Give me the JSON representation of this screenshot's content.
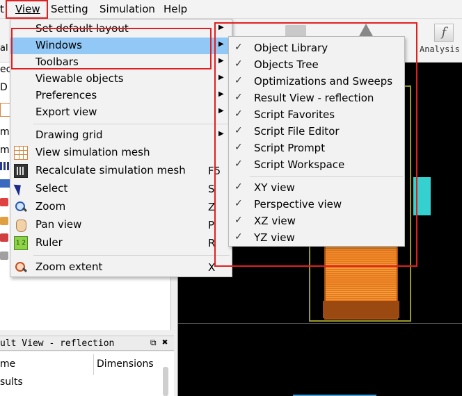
{
  "menubar": {
    "partial_left": "t",
    "view": "View",
    "setting": "Setting",
    "simulation": "Simulation",
    "help": "Help"
  },
  "toolbar": {
    "partial_left": "al",
    "analysis": "Analysis"
  },
  "left_panel": {
    "partial_chars": [
      "ec",
      "D",
      "m",
      "m"
    ]
  },
  "bottom_panel": {
    "title": "ult View - reflection",
    "float_btn": "⧉",
    "close_btn": "✖",
    "col_name": "me",
    "col_dimensions": "Dimensions",
    "row1": "sults"
  },
  "view_menu": {
    "items": [
      {
        "label": "Set default layout",
        "arrow": "▶"
      },
      {
        "label": "Windows",
        "arrow": "▶"
      },
      {
        "label": "Toolbars",
        "arrow": "▶"
      },
      {
        "label": "Viewable objects",
        "arrow": "▶"
      },
      {
        "label": "Preferences",
        "arrow": "▶"
      },
      {
        "label": "Export view",
        "arrow": "▶"
      },
      {
        "label": "Drawing grid",
        "arrow": "▶"
      },
      {
        "label": "View simulation mesh",
        "icon": "mesh-grid-icon"
      },
      {
        "label": "Recalculate simulation mesh",
        "shortcut": "F5",
        "icon": "recalculate-mesh-icon"
      },
      {
        "label": "Select",
        "shortcut": "S",
        "icon": "select-arrow-icon"
      },
      {
        "label": "Zoom",
        "shortcut": "Z",
        "icon": "zoom-icon"
      },
      {
        "label": "Pan view",
        "shortcut": "P",
        "icon": "pan-hand-icon"
      },
      {
        "label": "Ruler",
        "shortcut": "R",
        "icon": "ruler-icon",
        "icon_text": "1 2"
      },
      {
        "label": "Zoom extent",
        "shortcut": "X",
        "icon": "zoom-extent-icon"
      }
    ]
  },
  "windows_submenu": {
    "items": [
      {
        "label": "Object Library",
        "checked": "✓"
      },
      {
        "label": "Objects Tree",
        "checked": "✓"
      },
      {
        "label": "Optimizations and Sweeps",
        "checked": "✓"
      },
      {
        "label": "Result View - reflection",
        "checked": "✓"
      },
      {
        "label": "Script Favorites",
        "checked": "✓"
      },
      {
        "label": "Script File Editor",
        "checked": "✓"
      },
      {
        "label": "Script Prompt",
        "checked": "✓"
      },
      {
        "label": "Script Workspace",
        "checked": "✓"
      },
      {
        "label": "XY view",
        "checked": "✓"
      },
      {
        "label": "Perspective view",
        "checked": "✓"
      },
      {
        "label": "XZ view",
        "checked": "✓"
      },
      {
        "label": "YZ view",
        "checked": "✓"
      }
    ]
  },
  "colors": {
    "highlight": "#91c8f6",
    "annotation_red": "#e02020",
    "viewport_bg": "#000000"
  }
}
